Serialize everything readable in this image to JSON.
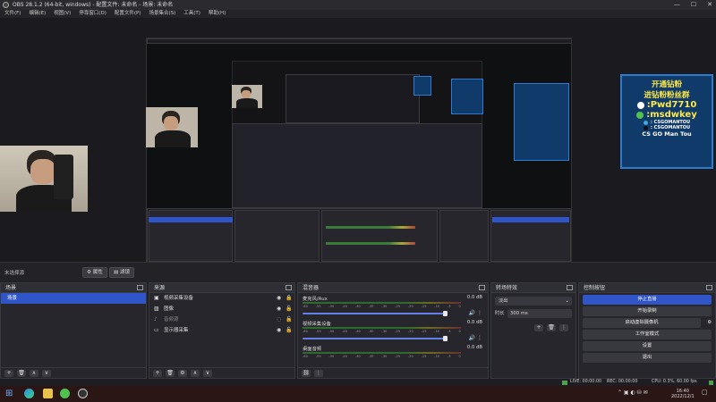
{
  "window": {
    "title": "OBS 28.1.2 (64-bit, windows) - 配置文件: 未命名 - 场景: 未命名",
    "controls": [
      "—",
      "☐",
      "✕"
    ]
  },
  "menu": [
    "文件(F)",
    "编辑(E)",
    "视图(V)",
    "停靠窗口(D)",
    "配置文件(P)",
    "场景集合(S)",
    "工具(T)",
    "帮助(H)"
  ],
  "promo": {
    "line1": "开通钻粉",
    "line2": "进钻粉粉丝群",
    "qq": ":Pwd7710",
    "wechat": ":msdwkey",
    "bilibili": ": CSGOMANTOU",
    "douyin": ": CSGOMANTOU",
    "brand": "CS GO Man Tou"
  },
  "scene_bar": {
    "label": "未选择源",
    "properties": "属性",
    "filters": "滤镜"
  },
  "scenes": {
    "title": "场景",
    "items": [
      "场景"
    ]
  },
  "sources": {
    "title": "来源",
    "items": [
      {
        "label": "视频采集设备",
        "icon": "camera-icon",
        "visible": true,
        "locked": true
      },
      {
        "label": "图像",
        "icon": "image-icon",
        "visible": true,
        "locked": false
      },
      {
        "label": "音频源",
        "icon": "audio-icon",
        "visible": false,
        "locked": false
      },
      {
        "label": "显示器采集",
        "icon": "monitor-icon",
        "visible": true,
        "locked": false
      }
    ]
  },
  "mixer": {
    "title": "混音器",
    "channels": [
      {
        "name": "麦克风/Aux",
        "db": "0.0 dB",
        "level": 0.82
      },
      {
        "name": "视频采集设备",
        "db": "0.0 dB",
        "level": 0.82
      },
      {
        "name": "桌面音频",
        "db": "0.0 dB",
        "level": 0.0
      }
    ],
    "scale": [
      "-60",
      "-55",
      "-50",
      "-45",
      "-40",
      "-35",
      "-30",
      "-25",
      "-20",
      "-15",
      "-10",
      "-5",
      "0"
    ]
  },
  "transitions": {
    "title": "转场特效",
    "type": "淡出",
    "duration_label": "时长",
    "duration": "300 ms"
  },
  "controls": {
    "title": "控制按钮",
    "buttons": [
      "停止直播",
      "开始录制",
      "启动虚拟摄像机",
      "工作室模式",
      "设置",
      "退出"
    ]
  },
  "status": {
    "live": "LIVE: 00:00:00",
    "rec": "REC: 00:00:00",
    "cpu": "CPU: 0.3%, 60.00 fps"
  },
  "taskbar": {
    "time": "16:40",
    "date": "2022/12/1"
  },
  "colors": {
    "accent": "#2f55c8",
    "panel": "#26262c",
    "background": "#1f1f24",
    "promo_text": "#ffe94a",
    "promo_bg": "#0f3a6a"
  }
}
